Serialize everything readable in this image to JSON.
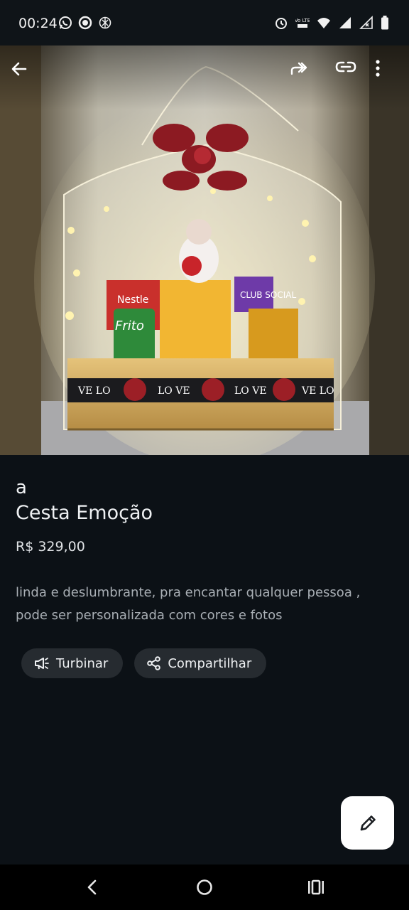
{
  "status_bar": {
    "time": "00:24",
    "left_icons": [
      "whatsapp-icon",
      "record-icon",
      "openai-icon"
    ],
    "right_icons": [
      "alarm-icon",
      "volte-icon",
      "wifi-icon",
      "signal-icon",
      "signal-icon-2",
      "battery-icon"
    ],
    "volte_label": "Vo LTE"
  },
  "toolbar": {
    "back_icon": "arrow-back-icon",
    "forward_icon": "forward-icon",
    "link_icon": "link-icon",
    "more_icon": "more-vert-icon"
  },
  "photo_text": {
    "brand_left": "Nestle",
    "brand_center": "Frito",
    "brand_right": "CLUB SOCIAL",
    "box_words": [
      "VE LO",
      "LO VE",
      "LO VE",
      "VE LO"
    ]
  },
  "product": {
    "subtitle": "a",
    "title": "Cesta Emoção",
    "price": "R$ 329,00",
    "description": "linda e deslumbrante,  pra encantar qualquer pessoa ,\npode ser personalizada com cores e fotos"
  },
  "actions": {
    "boost_label": "Turbinar",
    "share_label": "Compartilhar"
  },
  "fab": {
    "icon": "edit-icon"
  },
  "nav_bar": {
    "icons": [
      "nav-back-icon",
      "nav-home-icon",
      "nav-recents-icon"
    ]
  }
}
